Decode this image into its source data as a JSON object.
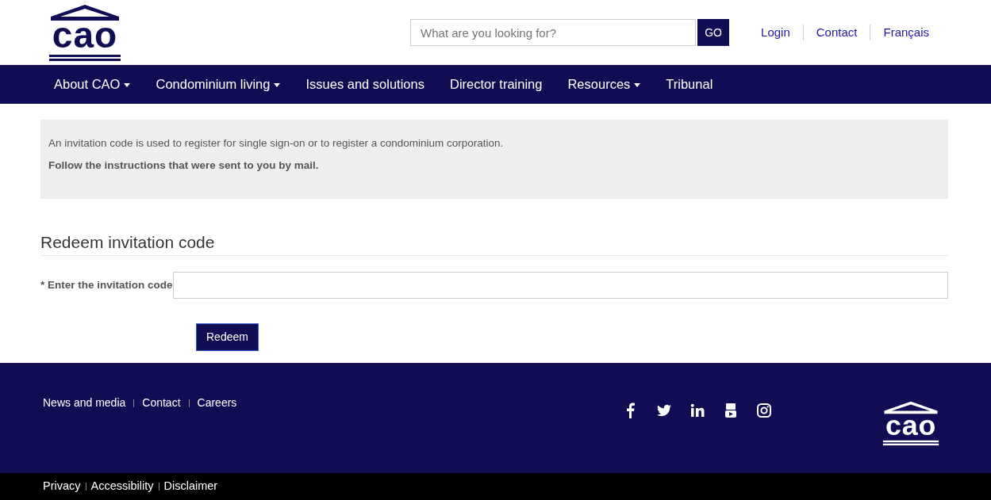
{
  "header": {
    "logo_text": "cao",
    "search": {
      "placeholder": "What are you looking for?",
      "button": "GO"
    },
    "links": [
      "Login",
      "Contact",
      "Français"
    ]
  },
  "nav": [
    {
      "label": "About CAO",
      "dropdown": true
    },
    {
      "label": "Condominium living",
      "dropdown": true
    },
    {
      "label": "Issues and solutions",
      "dropdown": false
    },
    {
      "label": "Director training",
      "dropdown": false
    },
    {
      "label": "Resources",
      "dropdown": true
    },
    {
      "label": "Tribunal",
      "dropdown": false
    }
  ],
  "notice": {
    "text": "An invitation code is used to register for single sign-on or to register a condominium corporation.",
    "instruction": "Follow the instructions that were sent to you by mail."
  },
  "form": {
    "title": "Redeem invitation code",
    "required_mark": "*",
    "label": "Enter the invitation code",
    "button": "Redeem"
  },
  "footer": {
    "links": [
      "News and media",
      "Contact",
      "Careers"
    ],
    "social": [
      {
        "kind": "facebook"
      },
      {
        "kind": "twitter"
      },
      {
        "kind": "linkedin"
      },
      {
        "kind": "youtube"
      },
      {
        "kind": "instagram"
      }
    ],
    "logo_text": "cao",
    "bottom_links": [
      "Privacy",
      "Accessibility",
      "Disclaimer"
    ]
  }
}
